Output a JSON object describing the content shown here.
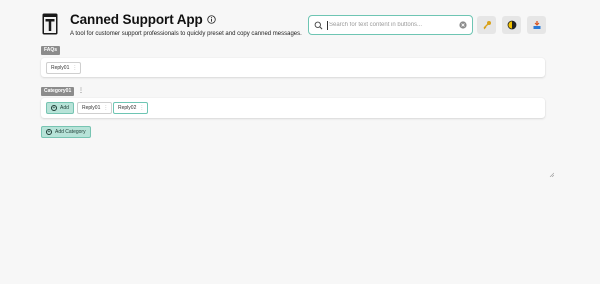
{
  "header": {
    "title": "Canned Support App",
    "subtitle": "A tool for customer support professionals to quickly preset and copy canned messages."
  },
  "search": {
    "placeholder": "Search for text content in buttons..."
  },
  "toolbar": {
    "icons": [
      "key-icon",
      "theme-toggle-icon",
      "import-export-icon"
    ]
  },
  "sections": [
    {
      "tag": "FAQs",
      "replies": [
        "Reply01"
      ]
    },
    {
      "tag": "Category01",
      "add_label": "Add",
      "replies": [
        "Reply01",
        "Reply02"
      ]
    }
  ],
  "add_category_label": "Add Category",
  "colors": {
    "accent": "#6ec5b3",
    "accent_fill": "#b7e3d8",
    "tag_bg": "#8c8c8c",
    "page_bg": "#f7f7f7"
  }
}
